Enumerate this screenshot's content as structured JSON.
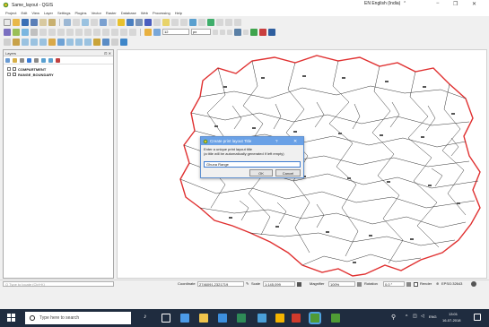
{
  "window": {
    "title": "Same_layout - QGIS",
    "language": "EN English (India)",
    "controls": [
      "−",
      "❐",
      "✕"
    ]
  },
  "menu": [
    "Project",
    "Edit",
    "View",
    "Layer",
    "Settings",
    "Plugins",
    "Vector",
    "Raster",
    "Database",
    "Web",
    "Processing",
    "Help"
  ],
  "toolbar": {
    "font_size": "12",
    "unit": "px"
  },
  "layers_panel": {
    "title": "Layers",
    "controls": "⊡ ✕",
    "layers": [
      {
        "name": "COMPARTMENT",
        "checked": true
      },
      {
        "name": "RANGE_BOUNDARY",
        "checked": true
      }
    ]
  },
  "dialog": {
    "title": "Create print layout Title",
    "help": "?",
    "close": "✕",
    "message_line1": "Enter a unique print layout title",
    "message_line2": "(a title will be automatically generated if left empty)",
    "input_value": "Ghuna Range",
    "ok_label": "OK",
    "cancel_label": "Cancel"
  },
  "statusbar": {
    "locator_placeholder": "Q  Type to locate (Ctrl+K)",
    "coordinate_label": "Coordinate",
    "coordinate_value": "2746091,2321719",
    "scale_label": "Scale",
    "scale_value": "1:145,099",
    "magnifier_label": "Magnifier",
    "magnifier_value": "100%",
    "rotation_label": "Rotation",
    "rotation_value": "0.0 °",
    "render_label": "Render",
    "crs_label": "EPSG:32643"
  },
  "taskbar": {
    "search_placeholder": "Type here to search",
    "time": "13:01",
    "date": "16-07-2018",
    "lang": "ENG"
  },
  "colors": {
    "map_outline": "#e03030",
    "dialog_title": "#6aa1e6",
    "taskbar": "#1f2c3f"
  }
}
